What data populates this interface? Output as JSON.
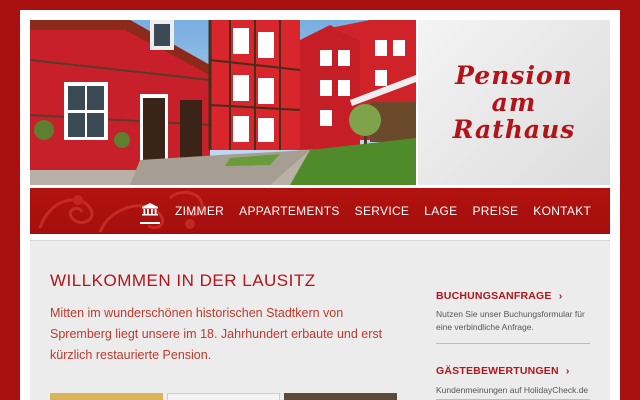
{
  "logo": {
    "line1": "Pension",
    "line2": "am",
    "line3": "Rathaus"
  },
  "nav": {
    "home_icon": "building-icon",
    "items": [
      "ZIMMER",
      "APPARTEMENTS",
      "SERVICE",
      "LAGE",
      "PREISE",
      "KONTAKT"
    ]
  },
  "main": {
    "title": "WILLKOMMEN IN DER LAUSITZ",
    "intro": "Mitten im wunderschönen historischen Stadtkern von Spremberg liegt unsere im 18. Jahrhundert erbaute und erst kürzlich restaurierte Pension."
  },
  "sidebar": {
    "booking": {
      "heading": "BUCHUNGSANFRAGE",
      "text": "Nutzen Sie unser Buchungsformular für eine verbindliche Anfrage."
    },
    "reviews": {
      "heading": "GÄSTEBEWERTUNGEN",
      "text": "Kundenmeinungen auf HolidayCheck.de"
    }
  },
  "colors": {
    "brand_red": "#b3141a",
    "page_bg": "#a8110f",
    "content_bg": "#ececec"
  }
}
